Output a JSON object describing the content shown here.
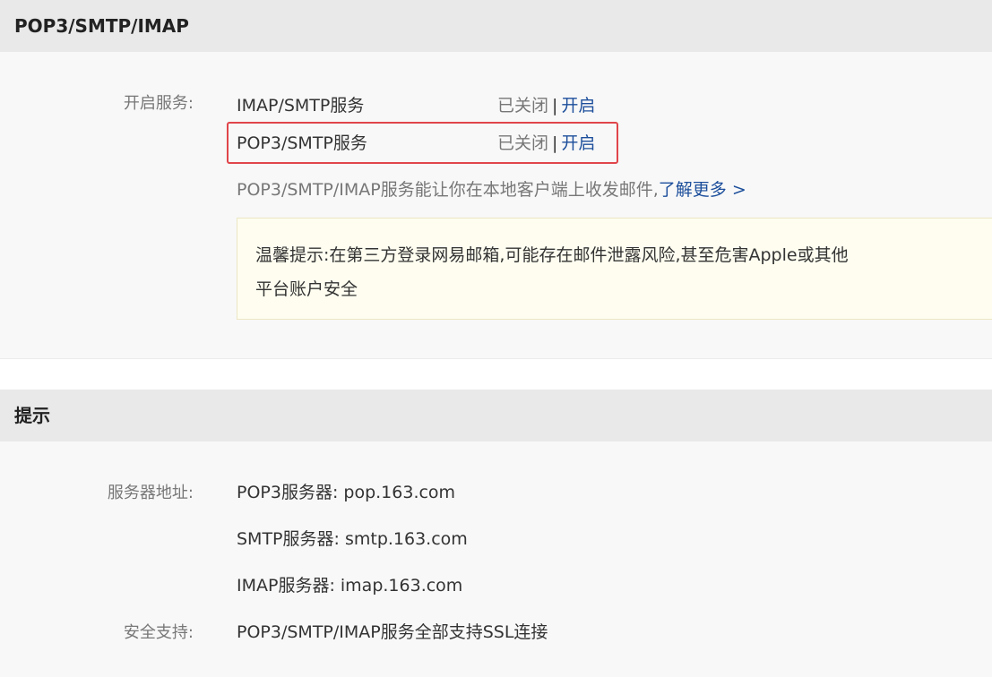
{
  "section1": {
    "title": "POP3/SMTP/IMAP",
    "services_label": "开启服务:",
    "services": [
      {
        "name": "IMAP/SMTP服务",
        "status": "已关闭",
        "separator": "|",
        "action": "开启"
      },
      {
        "name": "POP3/SMTP服务",
        "status": "已关闭",
        "separator": "|",
        "action": "开启"
      }
    ],
    "description": "POP3/SMTP/IMAP服务能让你在本地客户端上收发邮件,",
    "learn_more": "了解更多 >",
    "warning_line1": "温馨提示:在第三方登录网易邮箱,可能存在邮件泄露风险,甚至危害Apple或其他",
    "warning_line2": "平台账户安全",
    "highlight_color": "#e0454b",
    "link_color": "#1c4e9b"
  },
  "section2": {
    "title": "提示",
    "server_label": "服务器地址:",
    "servers": [
      "POP3服务器: pop.163.com",
      "SMTP服务器: smtp.163.com",
      "IMAP服务器: imap.163.com"
    ],
    "security_label": "安全支持:",
    "security_value": "POP3/SMTP/IMAP服务全部支持SSL连接"
  }
}
